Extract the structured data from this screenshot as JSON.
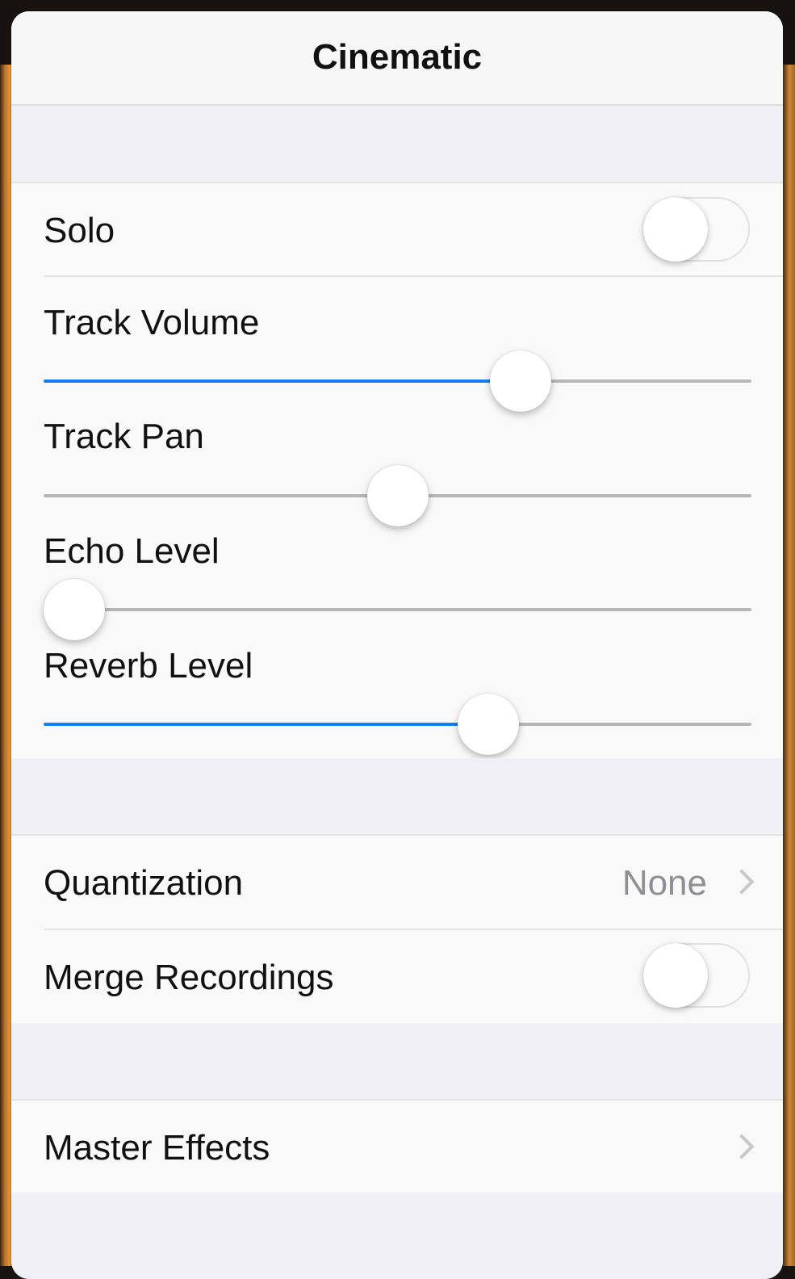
{
  "popover": {
    "title": "Cinematic"
  },
  "mixer": {
    "solo": {
      "label": "Solo",
      "on": false
    },
    "sliders": [
      {
        "label": "Track Volume",
        "value": 0.69,
        "filled": true
      },
      {
        "label": "Track Pan",
        "value": 0.5,
        "filled": false
      },
      {
        "label": "Echo Level",
        "value": 0.0,
        "filled": false
      },
      {
        "label": "Reverb Level",
        "value": 0.64,
        "filled": true
      }
    ]
  },
  "recording": {
    "quantization": {
      "label": "Quantization",
      "value": "None"
    },
    "merge": {
      "label": "Merge Recordings",
      "on": false
    }
  },
  "effects": {
    "master": {
      "label": "Master Effects"
    }
  },
  "colors": {
    "accent": "#1b7cf2",
    "background": "#f7f7f7",
    "group_gap": "#efeff4",
    "secondary_text": "#8e8e93"
  },
  "icons": {
    "disclosure": "chevron-right-icon"
  }
}
